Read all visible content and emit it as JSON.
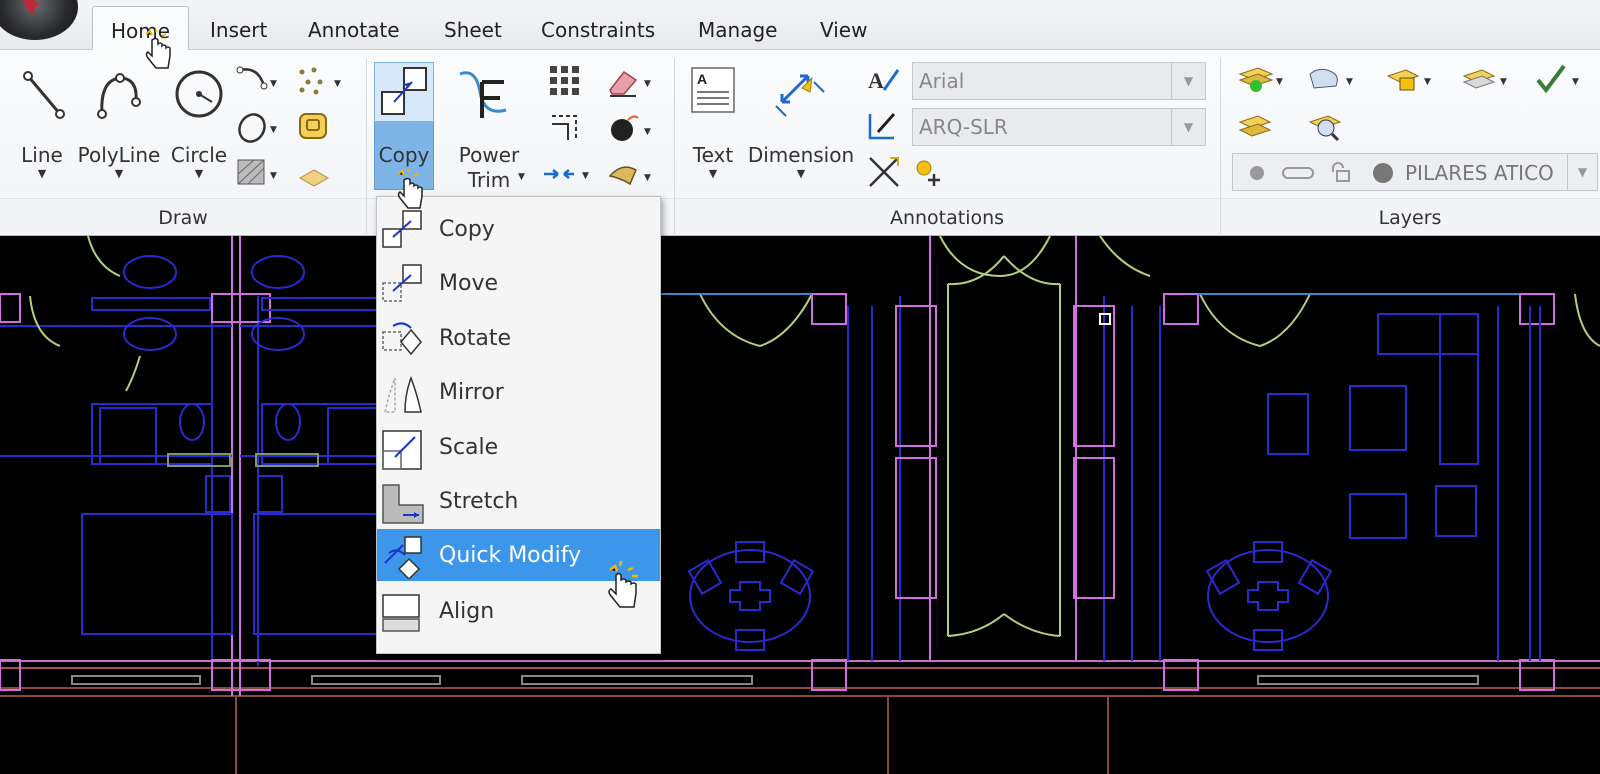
{
  "tabs": [
    {
      "label": "Home",
      "active": true
    },
    {
      "label": "Insert"
    },
    {
      "label": "Annotate"
    },
    {
      "label": "Sheet"
    },
    {
      "label": "Constraints"
    },
    {
      "label": "Manage"
    },
    {
      "label": "View"
    }
  ],
  "draw_group": {
    "label": "Draw",
    "line": "Line",
    "polyline": "PolyLine",
    "circle": "Circle"
  },
  "modify_group": {
    "copy": "Copy",
    "power_trim_1": "Power",
    "power_trim_2": "Trim"
  },
  "annotations_group": {
    "label": "Annotations",
    "text": "Text",
    "dimension": "Dimension",
    "font_value": "Arial",
    "dimstyle_value": "ARQ-SLR"
  },
  "layers_group": {
    "label": "Layers",
    "current_layer": "PILARES ATICO"
  },
  "copy_menu": {
    "items": [
      {
        "label": "Copy"
      },
      {
        "label": "Move"
      },
      {
        "label": "Rotate"
      },
      {
        "label": "Mirror"
      },
      {
        "label": "Scale"
      },
      {
        "label": "Stretch"
      },
      {
        "label": "Quick Modify",
        "selected": true
      },
      {
        "label": "Align"
      }
    ]
  },
  "colors": {
    "cad_background": "#000000",
    "wall_blue": "#2323d8",
    "wall_magenta": "#d070e0",
    "door_green": "#b4d07a",
    "menu_highlight": "#3c97ea"
  }
}
